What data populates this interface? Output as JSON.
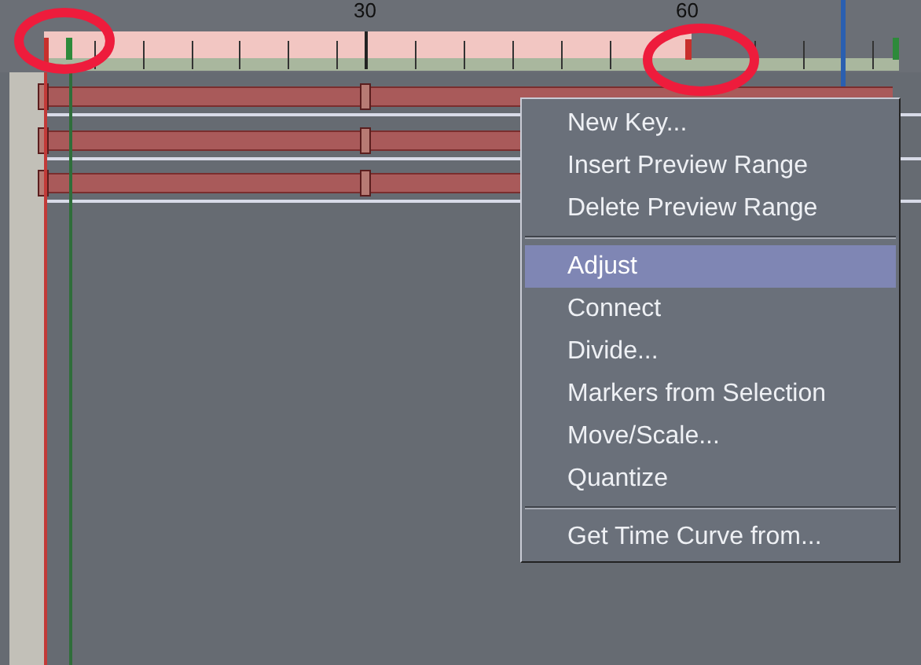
{
  "ruler": {
    "labels": [
      "30",
      "60"
    ]
  },
  "context_menu": {
    "items": [
      {
        "kind": "item",
        "label": "New Key...",
        "selected": false
      },
      {
        "kind": "item",
        "label": "Insert Preview Range",
        "selected": false
      },
      {
        "kind": "item",
        "label": "Delete Preview Range",
        "selected": false
      },
      {
        "kind": "separator"
      },
      {
        "kind": "item",
        "label": "Adjust",
        "selected": true
      },
      {
        "kind": "item",
        "label": "Connect",
        "selected": false
      },
      {
        "kind": "item",
        "label": "Divide...",
        "selected": false
      },
      {
        "kind": "item",
        "label": "Markers from Selection",
        "selected": false
      },
      {
        "kind": "item",
        "label": "Move/Scale...",
        "selected": false
      },
      {
        "kind": "item",
        "label": "Quantize",
        "selected": false
      },
      {
        "kind": "separator"
      },
      {
        "kind": "item",
        "label": "Get Time Curve from...",
        "selected": false
      }
    ]
  }
}
